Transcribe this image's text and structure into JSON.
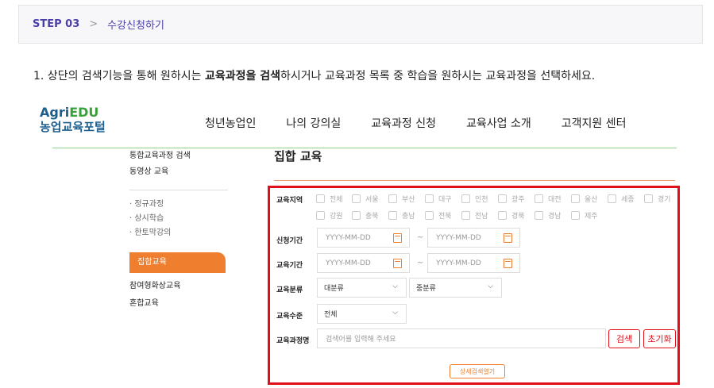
{
  "step": {
    "number": "STEP 03",
    "separator": ">",
    "title": "수강신청하기"
  },
  "instruction": {
    "prefix": "1. 상단의 검색기능을 통해 원하시는 ",
    "bold": "교육과정을 검색",
    "suffix": "하시거나 교육과정 목록 중 학습을 원하시는 교육과정을 선택하세요."
  },
  "logo": {
    "brand_a": "Agri",
    "brand_b": "EDU",
    "sub": "농업교육포털"
  },
  "gnb": [
    "청년농업인",
    "나의 강의실",
    "교육과정 신청",
    "교육사업 소개",
    "고객지원 센터"
  ],
  "lnb": {
    "top": [
      "통합교육과정 검색",
      "동영상 교육"
    ],
    "sub": [
      "· 정규과정",
      "· 상시학습",
      "· 한토막강의"
    ],
    "active": "집합교육",
    "bottom": [
      "참여형화상교육",
      "혼합교육"
    ]
  },
  "page_title": "집합 교육",
  "search": {
    "region_label": "교육지역",
    "regions_row1": [
      "전체",
      "서울",
      "부산",
      "대구",
      "인천",
      "광주",
      "대전",
      "울산",
      "세종",
      "경기"
    ],
    "regions_row2": [
      "강원",
      "충북",
      "충남",
      "전북",
      "전남",
      "경북",
      "경남",
      "제주"
    ],
    "apply_label": "신청기간",
    "edu_period_label": "교육기간",
    "date_placeholder": "YYYY-MM-DD",
    "tilde": "~",
    "category_label": "교육분류",
    "category_major": "대분류",
    "category_middle": "중분류",
    "level_label": "교육수준",
    "level_value": "전체",
    "course_label": "교육과정명",
    "course_placeholder": "검색어를 입력해 주세요",
    "search_button": "검색",
    "reset_button": "초기화",
    "detail_button": "상세검색열기",
    "chevron": "⌵"
  },
  "colors": {
    "accent_orange": "#ef7f2f",
    "highlight_red": "#e0101a",
    "step_purple": "#4a3fa8"
  }
}
